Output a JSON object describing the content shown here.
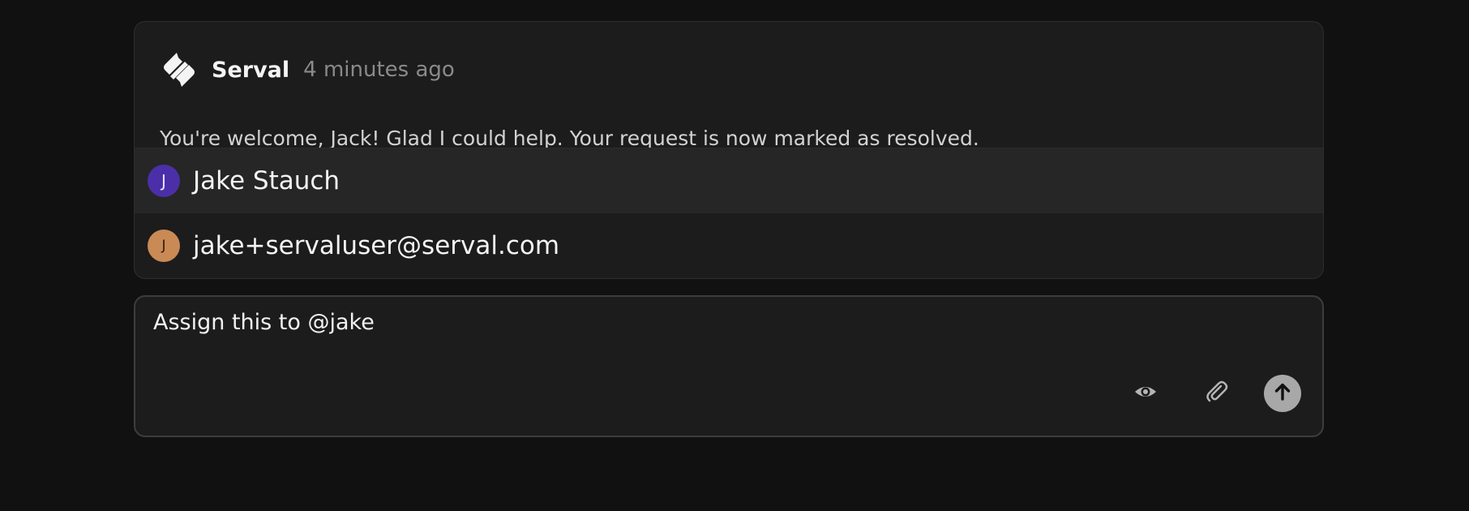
{
  "message": {
    "author": "Serval",
    "timestamp": "4 minutes ago",
    "body": "You're welcome, Jack! Glad I could help. Your request is now marked as resolved."
  },
  "mention_suggestions": [
    {
      "label": "Jake Stauch",
      "avatar_initial": "J",
      "avatar_color": "#4b2fa8",
      "highlighted": true
    },
    {
      "label": "jake+servaluser@serval.com",
      "avatar_initial": "J",
      "avatar_color": "#c98a55",
      "highlighted": false
    }
  ],
  "composer": {
    "value": "Assign this to @jake"
  },
  "icons": {
    "logo": "serval-logo-icon",
    "preview": "eye-icon",
    "attach": "paperclip-icon",
    "send": "arrow-up-icon"
  }
}
